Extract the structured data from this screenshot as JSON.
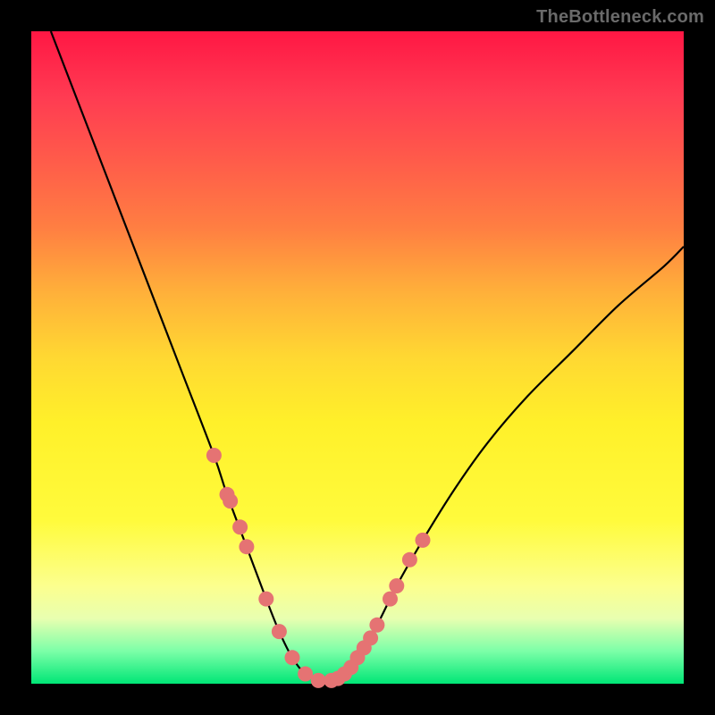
{
  "watermark": "TheBottleneck.com",
  "chart_data": {
    "type": "line",
    "title": "",
    "xlabel": "",
    "ylabel": "",
    "xlim": [
      0,
      100
    ],
    "ylim": [
      0,
      100
    ],
    "curve": {
      "x": [
        3,
        8,
        13,
        18,
        23,
        28,
        30,
        33,
        36,
        38,
        40,
        42,
        44,
        46,
        48,
        50,
        53,
        56,
        60,
        65,
        70,
        76,
        83,
        90,
        97,
        100
      ],
      "y": [
        100,
        87,
        74,
        61,
        48,
        35,
        29,
        21,
        13,
        8,
        4,
        1.5,
        0.5,
        0.5,
        1.5,
        4,
        9,
        15,
        22,
        30,
        37,
        44,
        51,
        58,
        64,
        67
      ]
    },
    "dots": {
      "x": [
        28,
        30,
        30.5,
        32,
        33,
        36,
        38,
        40,
        42,
        44,
        46,
        47,
        48,
        49,
        50,
        51,
        52,
        53,
        55,
        56,
        58,
        60
      ],
      "y": [
        35,
        29,
        28,
        24,
        21,
        13,
        8,
        4,
        1.5,
        0.5,
        0.5,
        0.8,
        1.5,
        2.5,
        4,
        5.5,
        7,
        9,
        13,
        15,
        19,
        22
      ]
    },
    "colors": {
      "curve": "#000000",
      "dots": "#e57373"
    }
  }
}
